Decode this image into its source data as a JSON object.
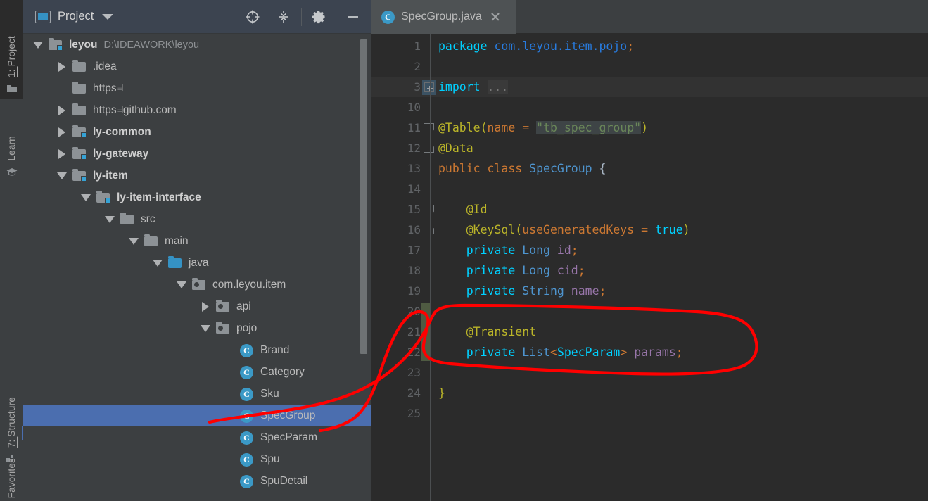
{
  "window": {
    "ide": "IntelliJ IDEA",
    "accent": "#4b6eaf",
    "annotation_color": "#ff0000"
  },
  "left_toolbar": {
    "buttons": [
      {
        "label_prefix": "1: ",
        "label": "Project",
        "icon": "folder-icon",
        "active": true
      },
      {
        "label_prefix": "",
        "label": "Learn",
        "icon": "graduation-cap-icon",
        "active": false
      },
      {
        "label_prefix": "7: ",
        "label": "Structure",
        "icon": "structure-icon",
        "active": false
      },
      {
        "label_prefix": "",
        "label": "Favorites",
        "icon": "star-icon",
        "active": false
      }
    ]
  },
  "project_panel": {
    "title": "Project",
    "title_icon": "project-view-icon",
    "dropdown_icon": "chevron-down-icon",
    "toolbar_buttons": [
      {
        "name": "scroll-from-source-button",
        "icon": "target-icon"
      },
      {
        "name": "collapse-all-button",
        "icon": "collapse-all-icon"
      },
      {
        "name": "settings-button",
        "icon": "gear-icon"
      },
      {
        "name": "hide-button",
        "icon": "minus-icon"
      }
    ],
    "tree": [
      {
        "label": "leyou",
        "path": "D:\\IDEAWORK\\leyou",
        "depth": 0,
        "toggle": "down",
        "icon": "module-folder-icon",
        "bold": true,
        "selected": false
      },
      {
        "label": ".idea",
        "path": "",
        "depth": 1,
        "toggle": "right",
        "icon": "folder-icon",
        "bold": false,
        "selected": false
      },
      {
        "label": "https⌸",
        "path": "",
        "depth": 1,
        "toggle": "none",
        "icon": "folder-icon",
        "bold": false,
        "selected": false
      },
      {
        "label": "https⌸github.com",
        "path": "",
        "depth": 1,
        "toggle": "right",
        "icon": "folder-icon",
        "bold": false,
        "selected": false
      },
      {
        "label": "ly-common",
        "path": "",
        "depth": 1,
        "toggle": "right",
        "icon": "module-folder-icon",
        "bold": true,
        "selected": false
      },
      {
        "label": "ly-gateway",
        "path": "",
        "depth": 1,
        "toggle": "right",
        "icon": "module-folder-icon",
        "bold": true,
        "selected": false
      },
      {
        "label": "ly-item",
        "path": "",
        "depth": 1,
        "toggle": "down",
        "icon": "module-folder-icon",
        "bold": true,
        "selected": false
      },
      {
        "label": "ly-item-interface",
        "path": "",
        "depth": 2,
        "toggle": "down",
        "icon": "module-folder-icon",
        "bold": true,
        "selected": false
      },
      {
        "label": "src",
        "path": "",
        "depth": 3,
        "toggle": "down",
        "icon": "folder-icon",
        "bold": false,
        "selected": false
      },
      {
        "label": "main",
        "path": "",
        "depth": 4,
        "toggle": "down",
        "icon": "folder-icon",
        "bold": false,
        "selected": false
      },
      {
        "label": "java",
        "path": "",
        "depth": 5,
        "toggle": "down",
        "icon": "source-folder-icon",
        "bold": false,
        "selected": false
      },
      {
        "label": "com.leyou.item",
        "path": "",
        "depth": 6,
        "toggle": "down",
        "icon": "package-icon",
        "bold": false,
        "selected": false
      },
      {
        "label": "api",
        "path": "",
        "depth": 7,
        "toggle": "right",
        "icon": "package-icon",
        "bold": false,
        "selected": false
      },
      {
        "label": "pojo",
        "path": "",
        "depth": 7,
        "toggle": "down",
        "icon": "package-icon",
        "bold": false,
        "selected": false
      },
      {
        "label": "Brand",
        "path": "",
        "depth": 8,
        "toggle": "none",
        "icon": "java-class-icon",
        "bold": false,
        "selected": false
      },
      {
        "label": "Category",
        "path": "",
        "depth": 8,
        "toggle": "none",
        "icon": "java-class-icon",
        "bold": false,
        "selected": false
      },
      {
        "label": "Sku",
        "path": "",
        "depth": 8,
        "toggle": "none",
        "icon": "java-class-icon",
        "bold": false,
        "selected": false
      },
      {
        "label": "SpecGroup",
        "path": "",
        "depth": 8,
        "toggle": "none",
        "icon": "java-class-icon",
        "bold": false,
        "selected": true
      },
      {
        "label": "SpecParam",
        "path": "",
        "depth": 8,
        "toggle": "none",
        "icon": "java-class-icon",
        "bold": false,
        "selected": false
      },
      {
        "label": "Spu",
        "path": "",
        "depth": 8,
        "toggle": "none",
        "icon": "java-class-icon",
        "bold": false,
        "selected": false
      },
      {
        "label": "SpuDetail",
        "path": "",
        "depth": 8,
        "toggle": "none",
        "icon": "java-class-icon",
        "bold": false,
        "selected": false
      }
    ]
  },
  "editor": {
    "tab": {
      "name": "SpecGroup.java",
      "icon": "java-class-icon",
      "close_icon": "close-icon",
      "active": true
    },
    "line_numbers": [
      "1",
      "2",
      "3",
      "10",
      "11",
      "12",
      "13",
      "14",
      "15",
      "16",
      "17",
      "18",
      "19",
      "20",
      "21",
      "22",
      "23",
      "24",
      "25"
    ],
    "caret_line_index": 2,
    "folded_placeholder": "...",
    "lines": [
      {
        "num": "1",
        "tokens": [
          {
            "t": "package ",
            "c": "kw2"
          },
          {
            "t": "com.leyou.item.pojo",
            "c": "pkgc"
          },
          {
            "t": ";",
            "c": "semi"
          }
        ]
      },
      {
        "num": "2",
        "tokens": []
      },
      {
        "num": "3",
        "tokens": [
          {
            "t": "import ",
            "c": "kw2"
          },
          {
            "t": "...",
            "c": "fold-placeholder"
          }
        ]
      },
      {
        "num": "10",
        "tokens": []
      },
      {
        "num": "11",
        "tokens": [
          {
            "t": "@Table",
            "c": "anno"
          },
          {
            "t": "(",
            "c": "anno"
          },
          {
            "t": "name",
            "c": "punc"
          },
          {
            "t": " = ",
            "c": "punc"
          },
          {
            "t": "\"tb_spec_group\"",
            "c": "strhl"
          },
          {
            "t": ")",
            "c": "anno"
          }
        ]
      },
      {
        "num": "12",
        "tokens": [
          {
            "t": "@Data",
            "c": "anno"
          }
        ]
      },
      {
        "num": "13",
        "tokens": [
          {
            "t": "public ",
            "c": "kw"
          },
          {
            "t": "class ",
            "c": "kw"
          },
          {
            "t": "SpecGroup",
            "c": "typ"
          },
          {
            "t": " {",
            "c": "pln"
          }
        ]
      },
      {
        "num": "14",
        "tokens": []
      },
      {
        "num": "15",
        "tokens": [
          {
            "t": "    @Id",
            "c": "anno"
          }
        ]
      },
      {
        "num": "16",
        "tokens": [
          {
            "t": "    @KeySql",
            "c": "anno"
          },
          {
            "t": "(",
            "c": "anno"
          },
          {
            "t": "useGeneratedKeys",
            "c": "punc"
          },
          {
            "t": " = ",
            "c": "punc"
          },
          {
            "t": "true",
            "c": "kw2b"
          },
          {
            "t": ")",
            "c": "anno"
          }
        ]
      },
      {
        "num": "17",
        "tokens": [
          {
            "t": "    private ",
            "c": "kw2"
          },
          {
            "t": "Long",
            "c": "typ"
          },
          {
            "t": " ",
            "c": "pln"
          },
          {
            "t": "id",
            "c": "fld2"
          },
          {
            "t": ";",
            "c": "semi"
          }
        ]
      },
      {
        "num": "18",
        "tokens": [
          {
            "t": "    private ",
            "c": "kw2"
          },
          {
            "t": "Long",
            "c": "typ"
          },
          {
            "t": " ",
            "c": "pln"
          },
          {
            "t": "cid",
            "c": "fld2"
          },
          {
            "t": ";",
            "c": "semi"
          }
        ]
      },
      {
        "num": "19",
        "tokens": [
          {
            "t": "    private ",
            "c": "kw2"
          },
          {
            "t": "String",
            "c": "typ"
          },
          {
            "t": " ",
            "c": "pln"
          },
          {
            "t": "name",
            "c": "fld2"
          },
          {
            "t": ";",
            "c": "semi"
          }
        ]
      },
      {
        "num": "20",
        "tokens": []
      },
      {
        "num": "21",
        "tokens": [
          {
            "t": "    @Transient",
            "c": "anno"
          }
        ]
      },
      {
        "num": "22",
        "tokens": [
          {
            "t": "    private ",
            "c": "kw2"
          },
          {
            "t": "List",
            "c": "typ"
          },
          {
            "t": "<",
            "c": "semi"
          },
          {
            "t": "SpecParam",
            "c": "kw2"
          },
          {
            "t": ">",
            "c": "semi"
          },
          {
            "t": " ",
            "c": "pln"
          },
          {
            "t": "params",
            "c": "fld2"
          },
          {
            "t": ";",
            "c": "semi"
          }
        ]
      },
      {
        "num": "23",
        "tokens": []
      },
      {
        "num": "24",
        "tokens": [
          {
            "t": "}",
            "c": "anno"
          }
        ]
      },
      {
        "num": "25",
        "tokens": []
      }
    ],
    "code_text": "package com.leyou.item.pojo;\n\nimport ...\n\n@Table(name = \"tb_spec_group\")\n@Data\npublic class SpecGroup {\n\n    @Id\n    @KeySql(useGeneratedKeys = true)\n    private Long id;\n    private Long cid;\n    private String name;\n\n    @Transient\n    private List<SpecParam> params;\n\n}",
    "change_marker": {
      "name": "vcs-changed-lines-marker",
      "color": "#4f5b42",
      "from_line": "20",
      "to_line": "22"
    },
    "fold_markers": [
      {
        "line": "3",
        "type": "plus"
      },
      {
        "line": "11",
        "type": "bracket-top"
      },
      {
        "line": "12",
        "type": "bracket-bottom"
      },
      {
        "line": "15",
        "type": "bracket-top"
      },
      {
        "line": "16",
        "type": "bracket-bottom"
      }
    ]
  },
  "annotation": {
    "name": "red-circle-highlight",
    "color": "#ff0000",
    "target": "private List<SpecParam> params;"
  }
}
